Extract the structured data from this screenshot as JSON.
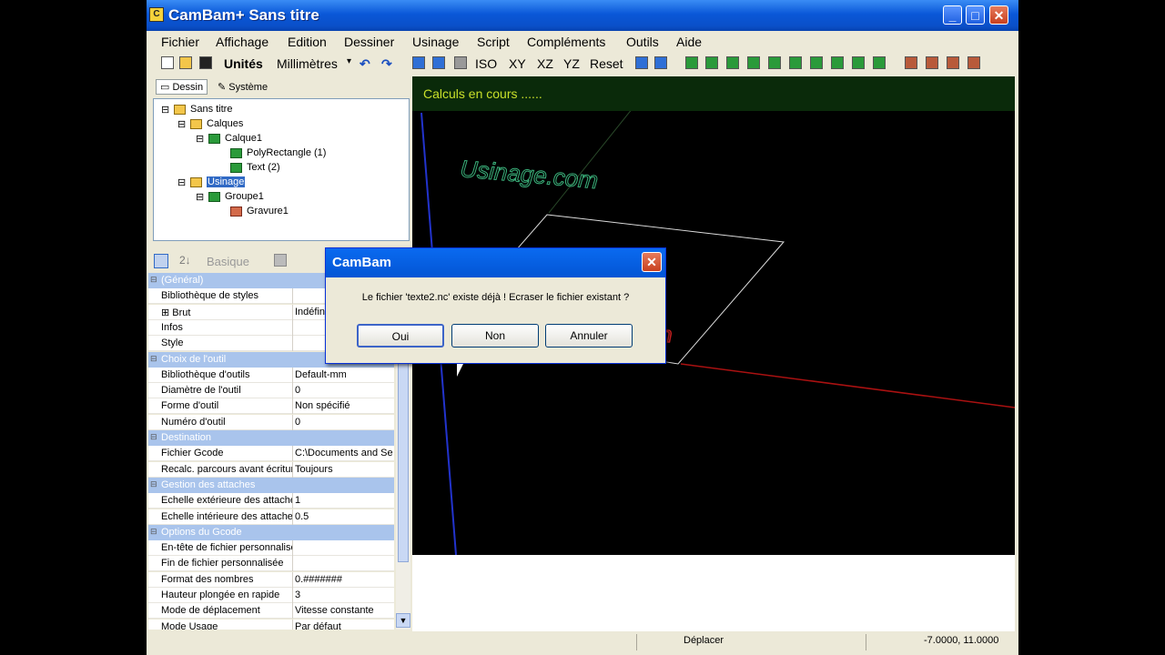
{
  "window": {
    "title": "CamBam+  Sans titre",
    "minimize": "_",
    "maximize": "□",
    "close": "✕"
  },
  "menu": [
    "Fichier",
    "Affichage",
    "Edition",
    "Dessiner",
    "Usinage",
    "Script",
    "Compléments",
    "Outils",
    "Aide"
  ],
  "toolbar": {
    "units_label": "Unités",
    "units_value": "Millimètres",
    "view_buttons": [
      "ISO",
      "XY",
      "XZ",
      "YZ",
      "Reset"
    ]
  },
  "tabs": [
    "Dessin",
    "Système"
  ],
  "tree": [
    {
      "label": "Sans titre"
    },
    {
      "label": "Calques"
    },
    {
      "label": "Calque1"
    },
    {
      "label": "PolyRectangle (1)"
    },
    {
      "label": "Text (2)"
    },
    {
      "label": "Usinage"
    },
    {
      "label": "Groupe1"
    },
    {
      "label": "Gravure1"
    }
  ],
  "property_grid": {
    "toolbar_label": "Basique",
    "rows": [
      {
        "k": "(Général)",
        "cat": true
      },
      {
        "k": "Bibliothèque de styles",
        "v": ""
      },
      {
        "k": "⊞ Brut",
        "v": "Indéfini"
      },
      {
        "k": "Infos",
        "v": ""
      },
      {
        "k": "Style",
        "v": ""
      },
      {
        "k": "Choix de l'outil",
        "cat": true
      },
      {
        "k": "Bibliothèque d'outils",
        "v": "Default-mm"
      },
      {
        "k": "Diamètre de l'outil",
        "v": "0"
      },
      {
        "k": "Forme d'outil",
        "v": "Non spécifié"
      },
      {
        "k": "Numéro d'outil",
        "v": "0"
      },
      {
        "k": "Destination",
        "cat": true
      },
      {
        "k": "Fichier Gcode",
        "v": "C:\\Documents and Se"
      },
      {
        "k": "Recalc. parcours avant écriture",
        "v": "Toujours"
      },
      {
        "k": "Gestion des attaches",
        "cat": true
      },
      {
        "k": "Echelle extérieure des attaches",
        "v": "1"
      },
      {
        "k": "Echelle intérieure des attaches",
        "v": "0.5"
      },
      {
        "k": "Options du Gcode",
        "cat": true
      },
      {
        "k": "En-tête de fichier personnalisé",
        "v": ""
      },
      {
        "k": "Fin de fichier personnalisée",
        "v": ""
      },
      {
        "k": "Format des nombres",
        "v": "0.#######"
      },
      {
        "k": "Hauteur plongée en rapide",
        "v": "3"
      },
      {
        "k": "Mode de déplacement",
        "v": "Vitesse constante"
      },
      {
        "k": "Mode Usage",
        "v": "Par défaut"
      }
    ]
  },
  "viewport": {
    "status_banner": "Calculs en cours ......",
    "watermark_text": "Usinage.com"
  },
  "statusbar": {
    "mode": "Déplacer",
    "coords": "-7.0000, 11.0000"
  },
  "dialog": {
    "title": "CamBam",
    "message": "Le fichier 'texte2.nc' existe déjà ! Ecraser le fichier existant ?",
    "buttons": [
      "Oui",
      "Non",
      "Annuler"
    ]
  },
  "colors": {
    "titlebar": "#0a58d8",
    "banner_text": "#c8e02a",
    "selection": "#316ac5"
  }
}
